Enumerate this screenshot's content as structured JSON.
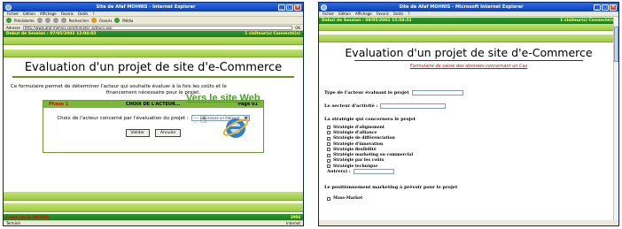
{
  "w1": {
    "title": "Site de Afaf MOHNIS - Internet Explorer",
    "menu": [
      "Fichier",
      "Edition",
      "Affichage",
      "Favoris",
      "Outils",
      "?"
    ],
    "toolbar": [
      "Précédente",
      "Rechercher",
      "Favoris",
      "Média"
    ],
    "address_label": "Adresse",
    "url": "http://www.afaf-mehnis.com/tri/lister_acteurs.asp",
    "go_label": "OK",
    "header_left": "Debut de Session : 07/05/2002 12:04:02",
    "header_right": "1 visiteur(s) Connecté(s)",
    "page_title": "Evaluation d'un projet de site d'e-Commerce",
    "intro_line1": "Ce formulaire permet de déterminer l'acteur qui souhaite évaluer à la fois les coûts et le",
    "intro_line2": "financement nécessaire pour le projet.",
    "phase_label": "Phase 1",
    "box_title": "CHOIX DE L'ACTEUR...",
    "page_label": "Page 01",
    "question": "Choix de l'acteur concerné par l'évaluation du projet :",
    "select_value": "---- Choisissez un élément... ----",
    "validate": "Valider",
    "cancel": "Annuler",
    "footer_left": "Conçu par A. MOHNIS",
    "footer_right": "2004",
    "status_left": "Terminé",
    "status_right": "Internet"
  },
  "w2": {
    "title": "Site de Afaf MOHNIS - Microsoft Internet Explorer",
    "menu": [
      "Fichier",
      "Edition",
      "Affichage",
      "Favoris",
      "Outils",
      "?"
    ],
    "header_left": "Debut de Session : 09/05/2002 15:58:52",
    "header_right": "1 visiteur(s) Connecté(s)",
    "page_title": "Evaluation d'un projet de site d'e-Commerce",
    "subtitle": "Formulaire de saisie des données concernant un Cas",
    "field_actor": "Type de l'acteur évaluant le projet",
    "field_sector": "Le secteur d'activité :",
    "strategy_heading": "La stratégie qui concernera le projet",
    "strategies": [
      "Stratégie d'alignement",
      "Stratégie d'alliance",
      "Stratégie de différenciation",
      "Stratégie d'innovation",
      "Stratégie flexibilité",
      "Stratégie marketing ou commercial",
      "Stratégie par les coûts",
      "Stratégie technique"
    ],
    "other_label": "Autre(s) :",
    "positioning": "Le positionnement marketing à prévoir pour le projet",
    "mass_market": "Mass-Market"
  },
  "link_text": "Vers le site Web"
}
